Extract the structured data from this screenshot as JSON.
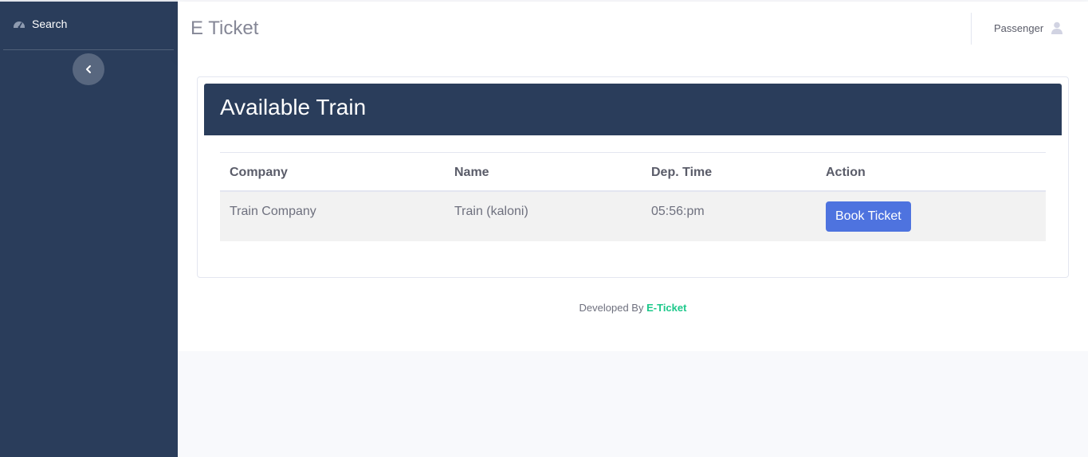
{
  "sidebar": {
    "search_label": "Search"
  },
  "topbar": {
    "title": "E Ticket",
    "user_name": "Passenger"
  },
  "main": {
    "card_title": "Available Train",
    "table": {
      "headers": [
        "Company",
        "Name",
        "Dep. Time",
        "Action"
      ],
      "rows": [
        {
          "company": "Train Company",
          "name": "Train (kaloni)",
          "dep_time": "05:56:pm",
          "action_label": "Book Ticket"
        }
      ]
    }
  },
  "footer": {
    "prefix": "Developed By",
    "brand": "E-Ticket"
  },
  "colors": {
    "sidebar_bg": "#2a3d5b",
    "primary_button": "#4e73df",
    "brand_green": "#1cc88a"
  },
  "icons": {
    "search": "dashboard-gauge-icon",
    "toggle": "chevron-left-icon",
    "user": "user-icon"
  }
}
